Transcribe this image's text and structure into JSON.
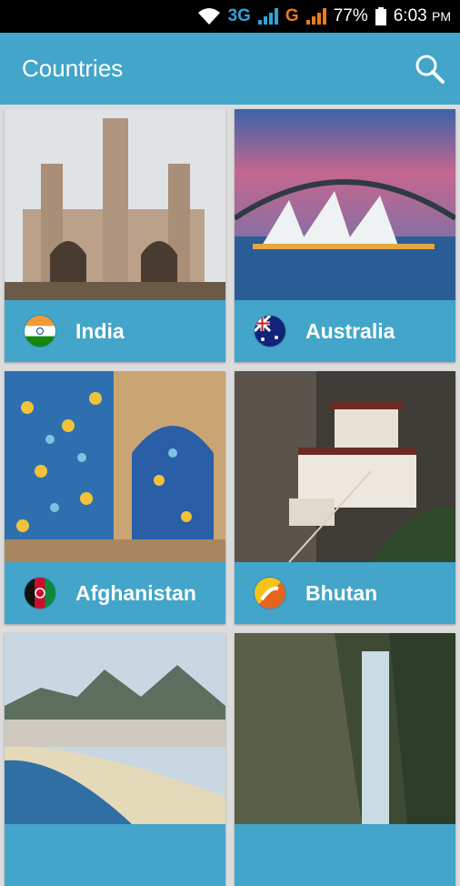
{
  "status": {
    "network": "3G",
    "g": "G",
    "battery": "77%",
    "time": "6:03",
    "ampm": "PM"
  },
  "appbar": {
    "title": "Countries",
    "search_icon": "search-icon"
  },
  "countries": [
    {
      "name": "India"
    },
    {
      "name": "Australia"
    },
    {
      "name": "Afghanistan"
    },
    {
      "name": "Bhutan"
    },
    {
      "name": ""
    },
    {
      "name": ""
    }
  ]
}
